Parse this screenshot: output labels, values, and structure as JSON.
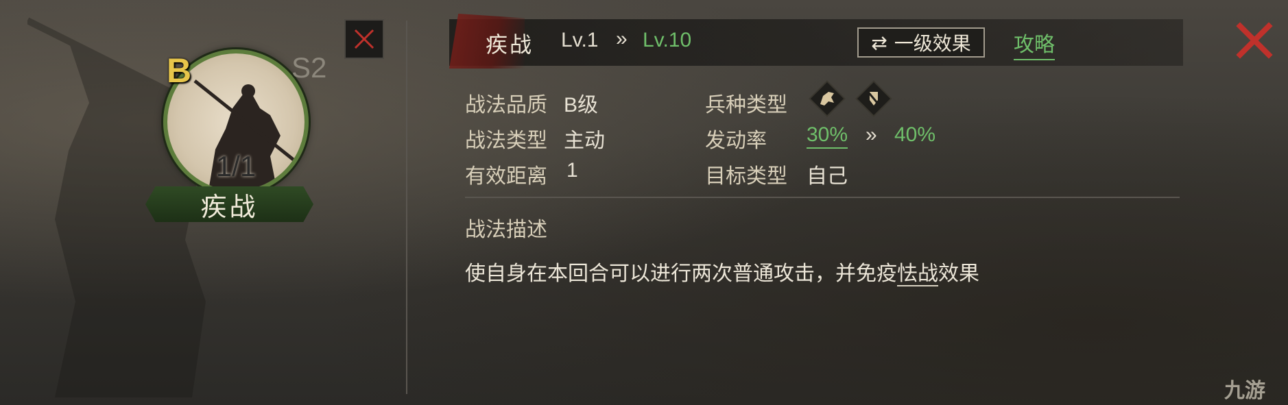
{
  "card": {
    "grade": "B",
    "season": "S2",
    "level_count": "1/1",
    "name": "疾战"
  },
  "header": {
    "title": "疾战",
    "level_from": "Lv.1",
    "level_arrow": "»",
    "level_to": "Lv.10",
    "effect_button_icon": "⇄",
    "effect_button_label": "一级效果",
    "guide_link": "攻略"
  },
  "attributes": {
    "quality_label": "战法品质",
    "quality_value": "B级",
    "type_label": "战法类型",
    "type_value": "主动",
    "range_label": "有效距离",
    "range_value": "1",
    "troop_label": "兵种类型",
    "rate_label": "发动率",
    "rate_from": "30%",
    "rate_arrow": "»",
    "rate_to": "40%",
    "target_label": "目标类型",
    "target_value": "自己"
  },
  "troop_icons": [
    "cavalry-icon",
    "shield-icon"
  ],
  "description": {
    "title": "战法描述",
    "text_before": "使自身在本回合可以进行两次普通攻击，并免疫",
    "keyword": "怯战",
    "text_after": "效果"
  },
  "watermark": "九游",
  "colors": {
    "highlight_green": "#6fbf6a",
    "grade_gold": "#e7c54a",
    "close_red": "#c0312b",
    "banner_green": "#2f4a24"
  }
}
